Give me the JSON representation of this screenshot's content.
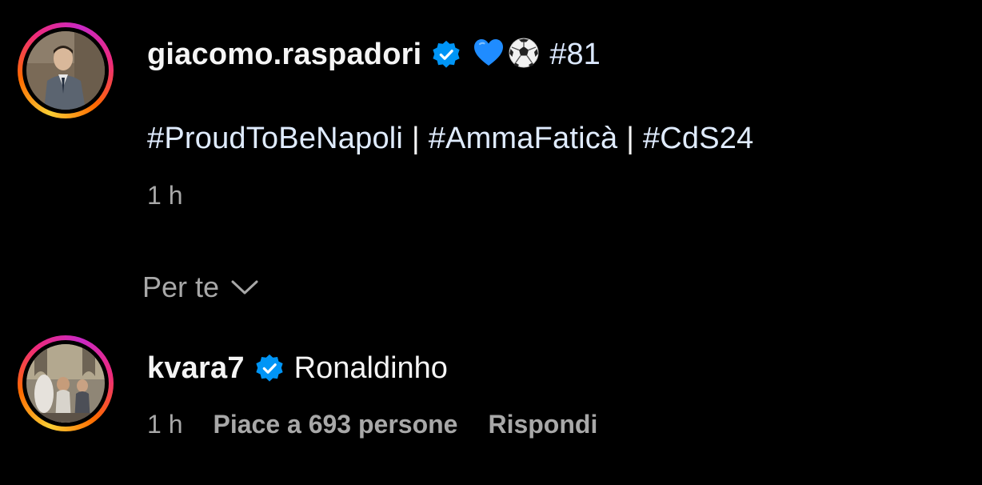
{
  "post": {
    "username": "giacomo.raspadori",
    "verified": true,
    "emoji_heart": "💙",
    "emoji_ball": "⚽",
    "number_tag": "#81",
    "hashtags": [
      "#ProudToBeNapoli",
      "#AmmaFaticà",
      "#CdS24"
    ],
    "separator": "|",
    "time": "1 h"
  },
  "filter": {
    "label": "Per te",
    "icon": "chevron-down-icon"
  },
  "comment": {
    "username": "kvara7",
    "verified": true,
    "text": "Ronaldinho",
    "time": "1 h",
    "likes": "Piace a 693 persone",
    "reply_label": "Rispondi"
  },
  "colors": {
    "background": "#000000",
    "text_primary": "#f5f5f5",
    "text_secondary": "#a8a8a8",
    "hashtag": "#e0ecff",
    "verified_badge": "#0095f6"
  }
}
